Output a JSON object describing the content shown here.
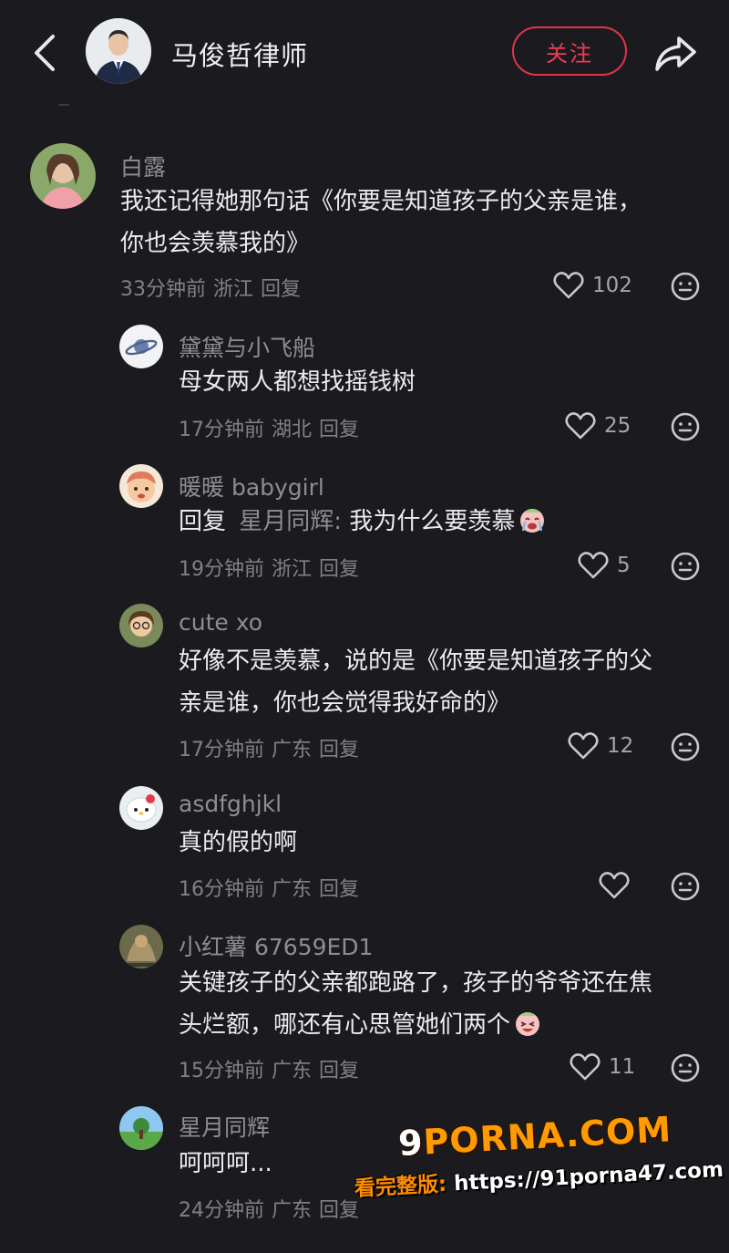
{
  "header": {
    "title": "马俊哲律师",
    "follow_label": "关注",
    "back_icon": "chevron-left-icon",
    "share_icon": "share-arrow-icon"
  },
  "colors": {
    "background": "#1b1b1f",
    "accent": "#e2334a",
    "text": "#ececee",
    "muted": "#8d8d93"
  },
  "comments": [
    {
      "name": "白露",
      "lines": [
        "我还记得她那句话《你要是知道孩子的父亲是谁，",
        "你也会羡慕我的》"
      ],
      "time": "33分钟前",
      "location": "浙江",
      "reply": "回复",
      "likes": "102"
    },
    {
      "name": "黛黛与小飞船",
      "lines": [
        "母女两人都想找摇钱树"
      ],
      "time": "17分钟前",
      "location": "湖北",
      "reply": "回复",
      "likes": "25"
    },
    {
      "name": "暖暖 babygirl",
      "lines": [
        "回复",
        "星月同辉:",
        "我为什么要羡慕"
      ],
      "time": "19分钟前",
      "location": "浙江",
      "reply": "回复",
      "likes": "5"
    },
    {
      "name": "cute xo",
      "lines": [
        "好像不是羡慕，说的是《你要是知道孩子的父",
        "亲是谁，你也会觉得我好命的》"
      ],
      "time": "17分钟前",
      "location": "广东",
      "reply": "回复",
      "likes": "12"
    },
    {
      "name": "asdfghjkl",
      "lines": [
        "真的假的啊"
      ],
      "time": "16分钟前",
      "location": "广东",
      "reply": "回复",
      "likes": ""
    },
    {
      "name": "小红薯 67659ED1",
      "lines": [
        "关键孩子的父亲都跑路了，孩子的爷爷还在焦",
        "头烂额，哪还有心思管她们两个"
      ],
      "time": "15分钟前",
      "location": "广东",
      "reply": "回复",
      "likes": "11"
    },
    {
      "name": "星月同辉",
      "lines": [
        "呵呵呵..."
      ],
      "time": "24分钟前",
      "location": "广东",
      "reply": "回复",
      "likes": ""
    }
  ],
  "watermark": {
    "brand_nine": "9",
    "brand_rest": "PORNA.COM",
    "url_label": "看完整版:",
    "url": "https://91porna47.com"
  }
}
